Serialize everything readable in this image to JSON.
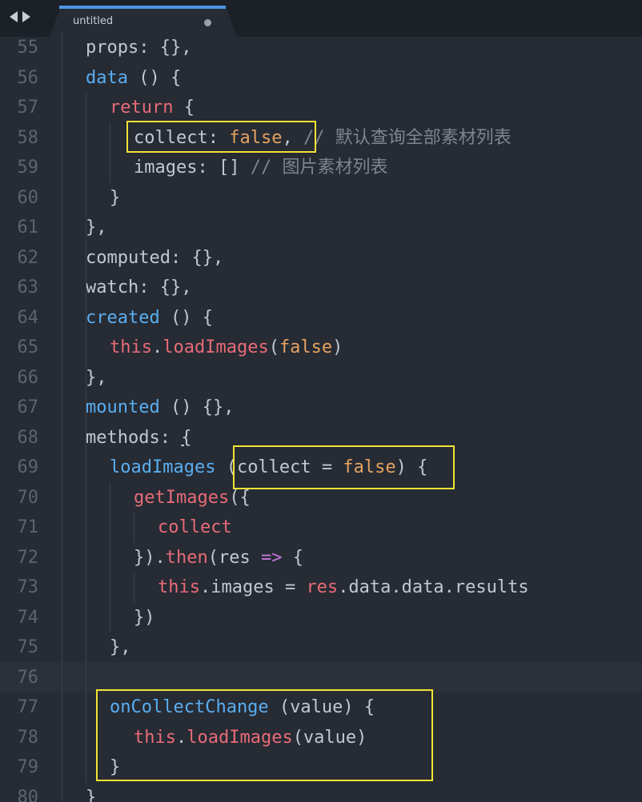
{
  "tab": {
    "title": "untitled"
  },
  "colors": {
    "background": "#262b34",
    "tabbar": "#1c2027",
    "tab_accent": "#4e95e3",
    "highlight_box": "#f1e332",
    "keyword_blue": "#5aaef0",
    "keyword_red": "#e86b77",
    "literal_orange": "#e5a262",
    "arrow_purple": "#c678dd",
    "comment_gray": "#7e848e"
  },
  "icons": {
    "back": "triangle-left",
    "forward": "triangle-right",
    "unsaved": "filled-circle"
  },
  "lines": [
    {
      "num": "55",
      "tokens": [
        [
          "props: {},",
          "plain"
        ]
      ]
    },
    {
      "num": "56",
      "tokens": [
        [
          "data",
          "blue"
        ],
        [
          " () {",
          "plain"
        ]
      ]
    },
    {
      "num": "57",
      "tokens": [
        [
          "return",
          "red"
        ],
        [
          " {",
          "plain"
        ]
      ]
    },
    {
      "num": "58",
      "tokens": [
        [
          "collect: ",
          "plain"
        ],
        [
          "false",
          "orange"
        ],
        [
          ", ",
          "plain"
        ],
        [
          "// 默认查询全部素材列表",
          "comment"
        ]
      ]
    },
    {
      "num": "59",
      "tokens": [
        [
          "images: [] ",
          "plain"
        ],
        [
          "// 图片素材列表",
          "comment"
        ]
      ]
    },
    {
      "num": "60",
      "tokens": [
        [
          "}",
          "plain"
        ]
      ]
    },
    {
      "num": "61",
      "tokens": [
        [
          "},",
          "plain"
        ]
      ]
    },
    {
      "num": "62",
      "tokens": [
        [
          "computed: {},",
          "plain"
        ]
      ]
    },
    {
      "num": "63",
      "tokens": [
        [
          "watch: {},",
          "plain"
        ]
      ]
    },
    {
      "num": "64",
      "tokens": [
        [
          "created",
          "blue"
        ],
        [
          " () {",
          "plain"
        ]
      ]
    },
    {
      "num": "65",
      "tokens": [
        [
          "this",
          "red"
        ],
        [
          ".",
          "plain"
        ],
        [
          "loadImages",
          "red"
        ],
        [
          "(",
          "plain"
        ],
        [
          "false",
          "orange"
        ],
        [
          ")",
          "plain"
        ]
      ]
    },
    {
      "num": "66",
      "tokens": [
        [
          "},",
          "plain"
        ]
      ]
    },
    {
      "num": "67",
      "tokens": [
        [
          "mounted",
          "blue"
        ],
        [
          " () {},",
          "plain"
        ]
      ]
    },
    {
      "num": "68",
      "tokens": [
        [
          "methods: ",
          "plain"
        ],
        [
          "{",
          "under"
        ]
      ]
    },
    {
      "num": "69",
      "tokens": [
        [
          "loadImages",
          "blue"
        ],
        [
          " (collect = ",
          "plain"
        ],
        [
          "false",
          "orange"
        ],
        [
          ") {",
          "plain"
        ]
      ]
    },
    {
      "num": "70",
      "tokens": [
        [
          "getImages",
          "red"
        ],
        [
          "({",
          "plain"
        ]
      ]
    },
    {
      "num": "71",
      "tokens": [
        [
          "collect",
          "red"
        ]
      ]
    },
    {
      "num": "72",
      "tokens": [
        [
          "}).",
          "plain"
        ],
        [
          "then",
          "red"
        ],
        [
          "(res ",
          "plain"
        ],
        [
          "=>",
          "purple"
        ],
        [
          " {",
          "plain"
        ]
      ]
    },
    {
      "num": "73",
      "tokens": [
        [
          "this",
          "red"
        ],
        [
          ".images = ",
          "plain"
        ],
        [
          "res",
          "red"
        ],
        [
          ".data.data.results",
          "plain"
        ]
      ]
    },
    {
      "num": "74",
      "tokens": [
        [
          "})",
          "plain"
        ]
      ]
    },
    {
      "num": "75",
      "tokens": [
        [
          "},",
          "plain"
        ]
      ]
    },
    {
      "num": "76",
      "tokens": []
    },
    {
      "num": "77",
      "tokens": [
        [
          "onCollectChange",
          "blue"
        ],
        [
          " (value) {",
          "plain"
        ]
      ]
    },
    {
      "num": "78",
      "tokens": [
        [
          "this",
          "red"
        ],
        [
          ".",
          "plain"
        ],
        [
          "loadImages",
          "red"
        ],
        [
          "(value)",
          "plain"
        ]
      ]
    },
    {
      "num": "79",
      "tokens": [
        [
          "}",
          "plain"
        ]
      ]
    },
    {
      "num": "80",
      "tokens": [
        [
          "}",
          "plain"
        ]
      ]
    }
  ]
}
